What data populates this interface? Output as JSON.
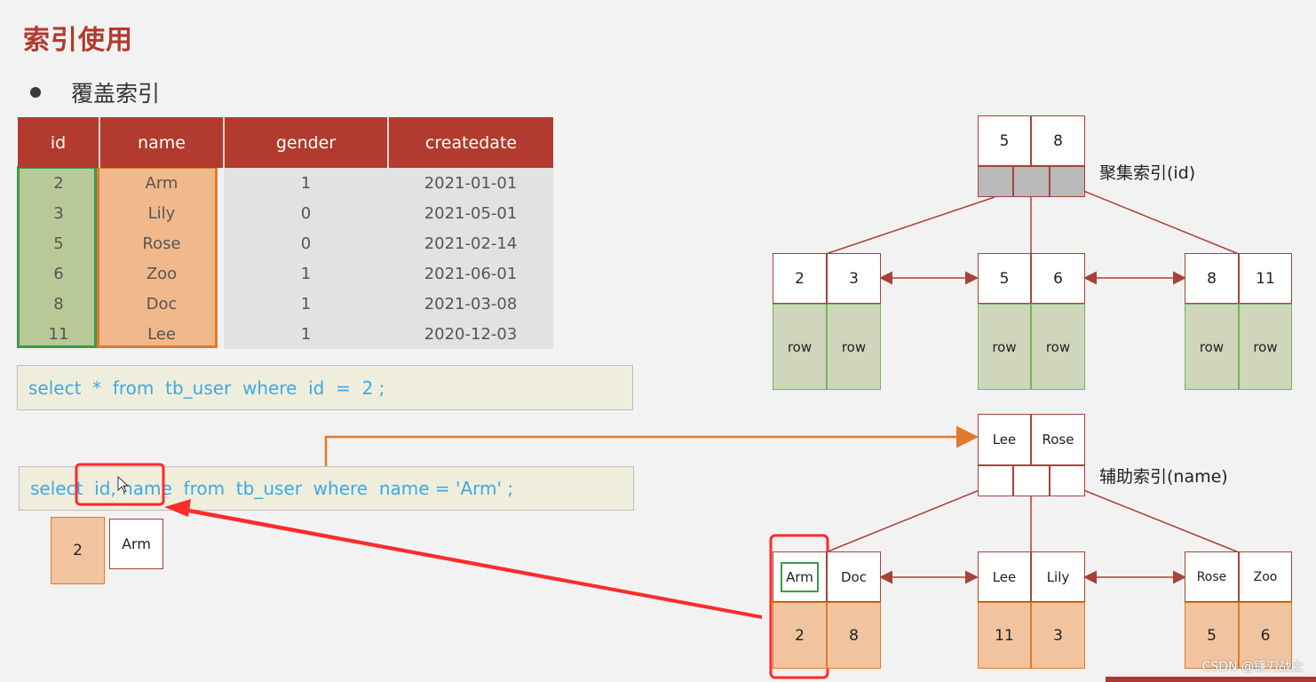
{
  "title": "索引使用",
  "bullet": "覆盖索引",
  "table": {
    "headers": [
      "id",
      "name",
      "gender",
      "createdate"
    ],
    "rows": [
      [
        "2",
        "Arm",
        "1",
        "2021-01-01"
      ],
      [
        "3",
        "Lily",
        "0",
        "2021-05-01"
      ],
      [
        "5",
        "Rose",
        "0",
        "2021-02-14"
      ],
      [
        "6",
        "Zoo",
        "1",
        "2021-06-01"
      ],
      [
        "8",
        "Doc",
        "1",
        "2021-03-08"
      ],
      [
        "11",
        "Lee",
        "1",
        "2020-12-03"
      ]
    ]
  },
  "sql": {
    "query1": "select  *  from  tb_user  where  id  =  2 ;",
    "query2": "select  id, name  from  tb_user  where  name = 'Arm' ;"
  },
  "result": {
    "id": "2",
    "name": "Arm"
  },
  "clustered": {
    "label": "聚集索引(id)",
    "root": [
      "5",
      "8"
    ],
    "leaves": [
      {
        "keys": [
          "2",
          "3"
        ],
        "rows": [
          "row",
          "row"
        ]
      },
      {
        "keys": [
          "5",
          "6"
        ],
        "rows": [
          "row",
          "row"
        ]
      },
      {
        "keys": [
          "8",
          "11"
        ],
        "rows": [
          "row",
          "row"
        ]
      }
    ]
  },
  "secondary": {
    "label": "辅助索引(name)",
    "root": [
      "Lee",
      "Rose"
    ],
    "leaves": [
      {
        "keys": [
          "Arm",
          "Doc"
        ],
        "vals": [
          "2",
          "8"
        ]
      },
      {
        "keys": [
          "Lee",
          "Lily"
        ],
        "vals": [
          "11",
          "3"
        ]
      },
      {
        "keys": [
          "Rose",
          "Zoo"
        ],
        "vals": [
          "5",
          "6"
        ]
      }
    ]
  },
  "watermark": "CSDN @镰刀战士",
  "colors": {
    "accent": "#b23a2e",
    "green": "#3d9a4b",
    "orange": "#e07a2b",
    "red": "#ff2a2a",
    "sql_text": "#3fa8df"
  }
}
